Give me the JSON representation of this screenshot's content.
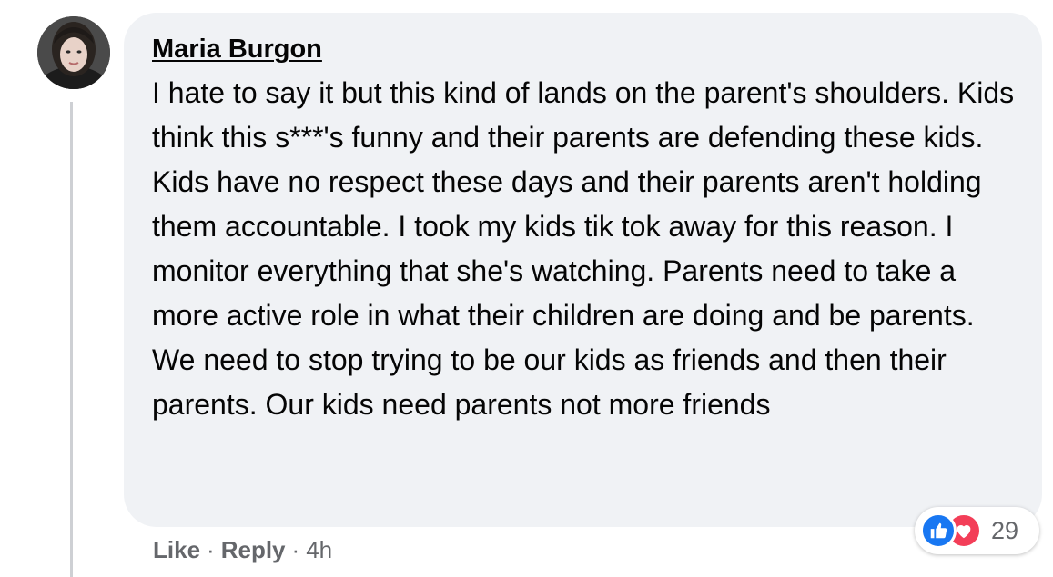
{
  "comment": {
    "author": "Maria Burgon",
    "text": "I hate to say it but this kind of lands on the parent's shoulders. Kids think this s***'s funny and their parents are defending these kids. Kids have no respect these days and their parents aren't holding them accountable. I took my kids tik tok away for this reason. I monitor everything that she's watching. Parents need to take a more active role in what their children are doing and be parents. We need to stop trying to be our kids as friends and then their parents. Our kids need parents not more friends",
    "reactions": {
      "icons": [
        "like-icon",
        "love-icon"
      ],
      "count": "29"
    },
    "actions": {
      "like_label": "Like",
      "reply_label": "Reply",
      "separator": "·",
      "timestamp": "4h"
    }
  },
  "colors": {
    "bubble_bg": "#f0f2f5",
    "text": "#050505",
    "secondary_text": "#65676b",
    "like_blue": "#1877f2",
    "love_red": "#f33e58"
  }
}
